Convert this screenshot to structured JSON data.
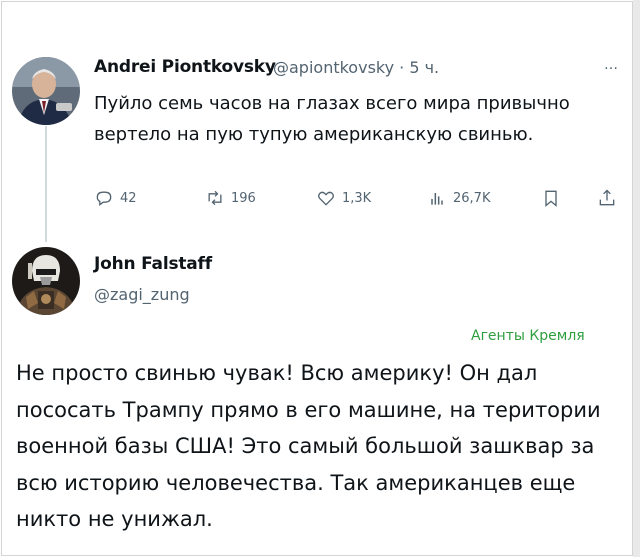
{
  "colors": {
    "text": "#0f1419",
    "secondary": "#536471",
    "divider": "#cfd9de",
    "green_label": "#2f9e3f"
  },
  "tweet": {
    "author_name": "Andrei Piontkovsky",
    "handle_time": "@apiontkovsky · 5 ч.",
    "more_icon": "…",
    "text": "Пуйло семь часов на глазах всего мира привычно вертело на пую тупую американскую свинью.",
    "actions": {
      "replies": "42",
      "retweets": "196",
      "likes": "1,3K",
      "views": "26,7K",
      "icons": [
        "reply-icon",
        "retweet-icon",
        "like-icon",
        "views-icon",
        "bookmark-icon",
        "share-icon"
      ]
    }
  },
  "reply": {
    "author_name": "John Falstaff",
    "handle": "@zagi_zung",
    "label": "Агенты Кремля",
    "text": "Не просто свинью чувак! Всю америку! Он дал пососать Трампу прямо в его машине, на територии военной базы США! Это самый большой зашквар за всю историю человечества. Так американцев еще никто не унижал."
  }
}
